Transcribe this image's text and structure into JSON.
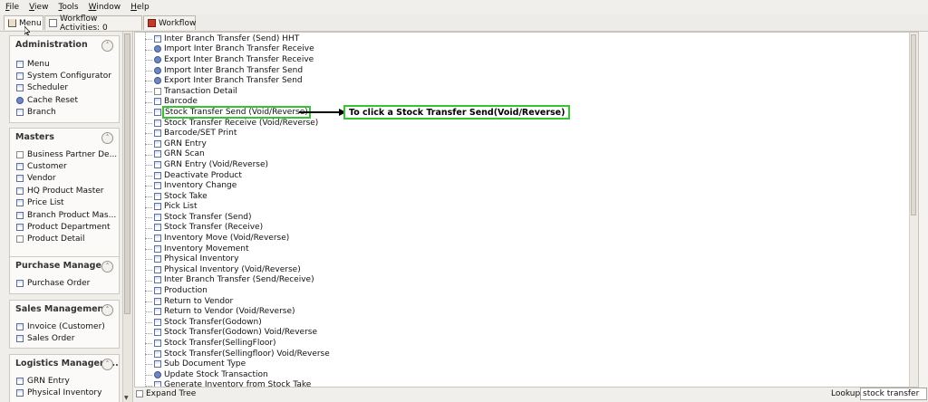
{
  "menubar": [
    {
      "label": "File",
      "hot": "F",
      "rest": "ile"
    },
    {
      "label": "View",
      "hot": "V",
      "rest": "iew"
    },
    {
      "label": "Tools",
      "hot": "T",
      "rest": "ools"
    },
    {
      "label": "Window",
      "hot": "W",
      "rest": "indow"
    },
    {
      "label": "Help",
      "hot": "H",
      "rest": "elp"
    }
  ],
  "tabs": {
    "menu": "Menu",
    "workflow_activities": "Workflow Activities: 0",
    "workflow": "Workflow"
  },
  "sidebar": {
    "administration": {
      "title": "Administration",
      "items": [
        "Menu",
        "System Configurator",
        "Scheduler",
        "Cache Reset",
        "Branch"
      ]
    },
    "masters": {
      "title": "Masters",
      "items": [
        "Business Partner De...",
        "Customer",
        "Vendor",
        "HQ Product Master",
        "Price List",
        "Branch Product Mas...",
        "Product Department",
        "Product Detail"
      ]
    },
    "purchase": {
      "title": "Purchase Manage...",
      "items": [
        "Purchase Order"
      ]
    },
    "sales": {
      "title": "Sales Management",
      "items": [
        "Invoice (Customer)",
        "Sales Order"
      ]
    },
    "logistics": {
      "title": "Logistics Managem...",
      "items": [
        "GRN Entry",
        "Physical Inventory"
      ]
    }
  },
  "tree_items": [
    "Inter Branch Transfer (Send) HHT",
    "Import Inter Branch Transfer Receive",
    "Export Inter Branch Transfer Receive",
    "Import Inter Branch Transfer Send",
    "Export Inter Branch Transfer Send",
    "Transaction Detail",
    "Barcode",
    "Stock Transfer Send (Void/Reverse)",
    "Stock Transfer Receive (Void/Reverse)",
    "Barcode/SET Print",
    "GRN Entry",
    "GRN Scan",
    "GRN Entry (Void/Reverse)",
    "Deactivate Product",
    "Inventory Change",
    "Stock Take",
    "Pick List",
    "Stock Transfer (Send)",
    "Stock Transfer (Receive)",
    "Inventory Move (Void/Reverse)",
    "Inventory Movement",
    "Physical Inventory",
    "Physical Inventory (Void/Reverse)",
    "Inter Branch Transfer (Send/Receive)",
    "Production",
    "Return to Vendor",
    "Return to Vendor (Void/Reverse)",
    "Stock Transfer(Godown)",
    "Stock Transfer(Godown) Void/Reverse",
    "Stock Transfer(SellingFloor)",
    "Stock Transfer(Sellingfloor) Void/Reverse",
    "Sub Document Type",
    "Update Stock Transaction",
    "Generate Inventory from Stock Take"
  ],
  "annotation": "To click a Stock Transfer Send(Void/Reverse)",
  "footer": {
    "expand_tree": "Expand Tree",
    "lookup_label": "Lookup",
    "lookup_value": "stock transfer"
  }
}
